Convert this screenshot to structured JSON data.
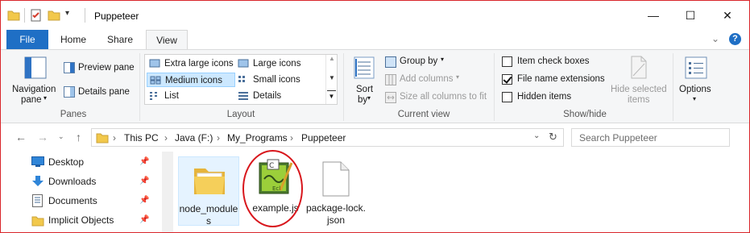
{
  "window": {
    "title": "Puppeteer",
    "controls": {
      "minimize": "—",
      "maximize": "☐",
      "close": "✕"
    }
  },
  "ribbon_tabs": [
    {
      "label": "File"
    },
    {
      "label": "Home"
    },
    {
      "label": "Share"
    },
    {
      "label": "View"
    }
  ],
  "panes": {
    "navigation_pane": "Navigation",
    "navigation_pane_2": "pane",
    "preview_pane": "Preview pane",
    "details_pane": "Details pane",
    "group_label": "Panes"
  },
  "layout": {
    "items": [
      {
        "label": "Extra large icons"
      },
      {
        "label": "Large icons"
      },
      {
        "label": "Medium icons"
      },
      {
        "label": "Small icons"
      },
      {
        "label": "List"
      },
      {
        "label": "Details"
      }
    ],
    "selected": "Medium icons",
    "group_label": "Layout"
  },
  "current_view": {
    "sort_by": "Sort",
    "sort_by_2": "by",
    "group_by": "Group by",
    "add_columns": "Add columns",
    "size_all_columns": "Size all columns to fit",
    "group_label": "Current view"
  },
  "show_hide": {
    "item_check_boxes": "Item check boxes",
    "file_name_extensions": "File name extensions",
    "hidden_items": "Hidden items",
    "hide_selected": "Hide selected",
    "hide_selected_2": "items",
    "group_label": "Show/hide",
    "checked": {
      "item_check_boxes": false,
      "file_name_extensions": true,
      "hidden_items": false
    }
  },
  "options": {
    "label": "Options"
  },
  "address": {
    "crumbs": [
      "This PC",
      "Java (F:)",
      "My_Programs",
      "Puppeteer"
    ]
  },
  "search": {
    "placeholder": "Search Puppeteer"
  },
  "nav_pane": {
    "items": [
      {
        "label": "Desktop",
        "icon": "desktop-icon"
      },
      {
        "label": "Downloads",
        "icon": "download-arrow-icon"
      },
      {
        "label": "Documents",
        "icon": "document-icon"
      },
      {
        "label": "Implicit Objects",
        "icon": "folder-icon"
      }
    ]
  },
  "files": [
    {
      "label": "node_modules",
      "icon": "folder-icon"
    },
    {
      "label": "example.js",
      "icon": "js-script-icon"
    },
    {
      "label": "package-lock.json",
      "icon": "blank-file-icon"
    }
  ],
  "colors": {
    "file_tab": "#1f6fc5",
    "selection": "#cce8ff",
    "annotation_circle": "#d8161c",
    "frame_border": "#d9262b",
    "folder": "#f2c84b"
  }
}
